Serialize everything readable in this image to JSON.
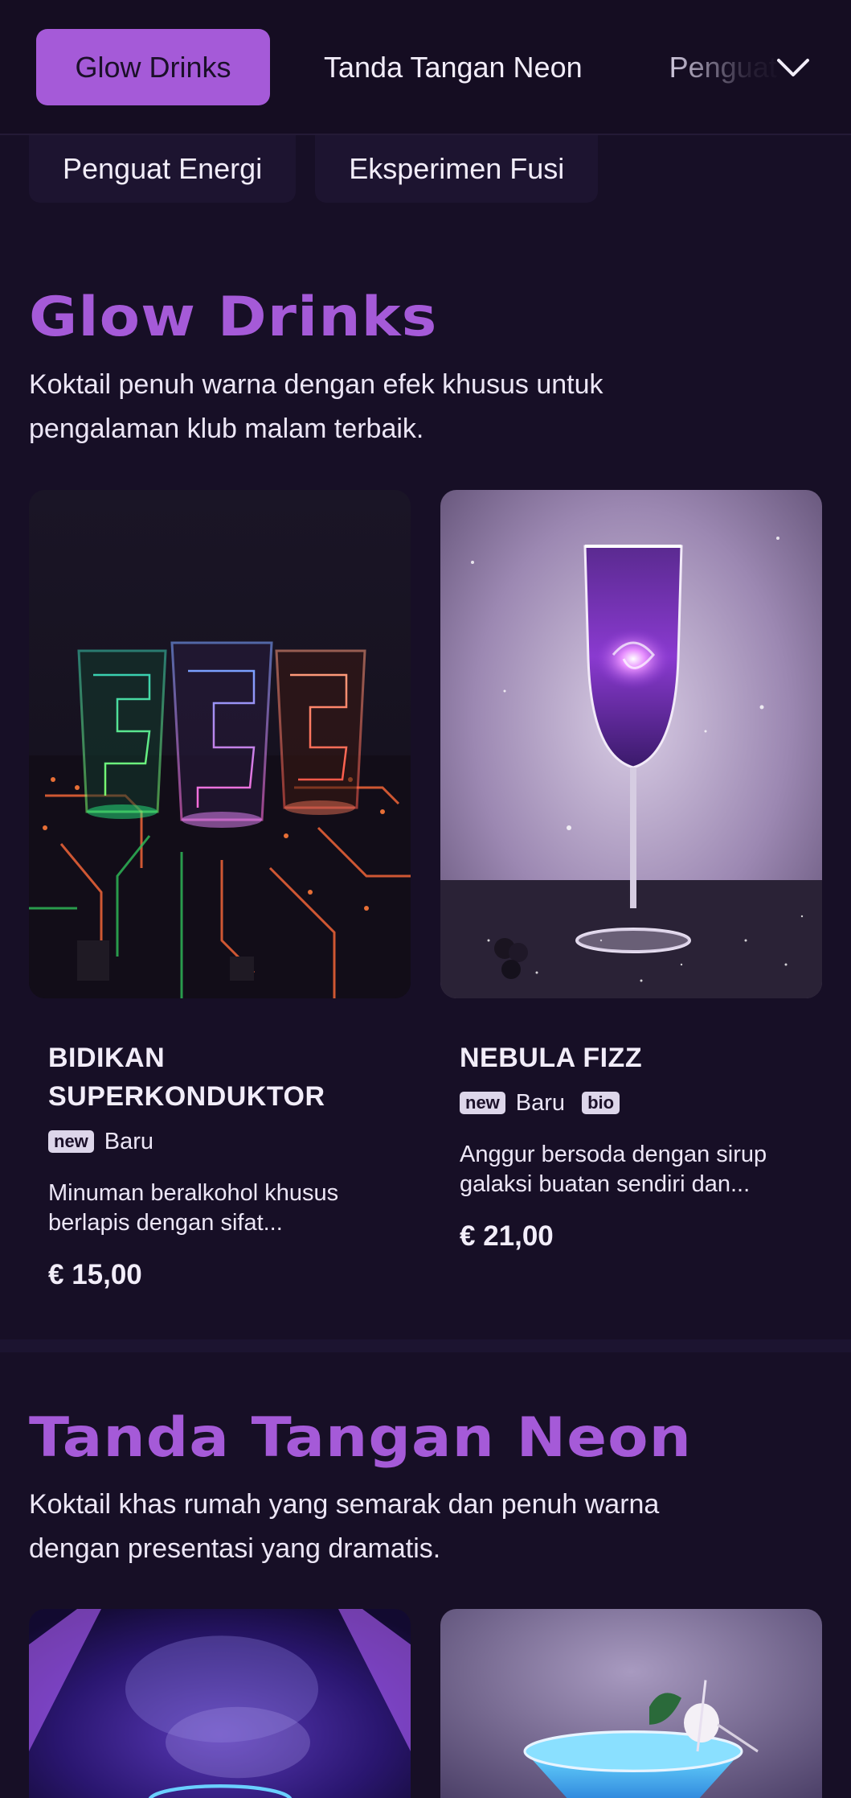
{
  "nav": {
    "tabs": [
      {
        "label": "Glow Drinks",
        "active": true
      },
      {
        "label": "Tanda Tangan Neon",
        "active": false
      },
      {
        "label": "Penguat Energi",
        "active": false
      }
    ],
    "secondary_tabs": [
      "Penguat Energi",
      "Eksperimen Fusi"
    ],
    "expand_icon": "chevron-down-icon"
  },
  "sections": [
    {
      "title": "Glow Drinks",
      "description": "Koktail penuh warna dengan efek khusus untuk pengalaman klub malam terbaik.",
      "items": [
        {
          "name": "BIDIKAN SUPERKONDUKTOR",
          "tags": [
            {
              "badge": "new",
              "label": "Baru"
            }
          ],
          "description": "Minuman beralkohol khusus berlapis dengan sifat...",
          "price": "€ 15,00",
          "image": "neon-circuit-shot-glasses"
        },
        {
          "name": "NEBULA FIZZ",
          "tags": [
            {
              "badge": "new",
              "label": "Baru"
            },
            {
              "badge": "bio",
              "label": ""
            }
          ],
          "description": "Anggur bersoda dengan sirup galaksi buatan sendiri dan...",
          "price": "€ 21,00",
          "image": "galaxy-champagne-flute"
        }
      ]
    },
    {
      "title": "Tanda Tangan Neon",
      "description": "Koktail khas rumah yang semarak dan penuh warna dengan presentasi yang dramatis.",
      "items": [
        {
          "image": "smoky-neon-cocktail"
        },
        {
          "image": "blue-cocktail-with-lychee"
        }
      ]
    }
  ],
  "colors": {
    "background": "#170f26",
    "accent": "#a55ad8",
    "text": "#ece6f6"
  }
}
